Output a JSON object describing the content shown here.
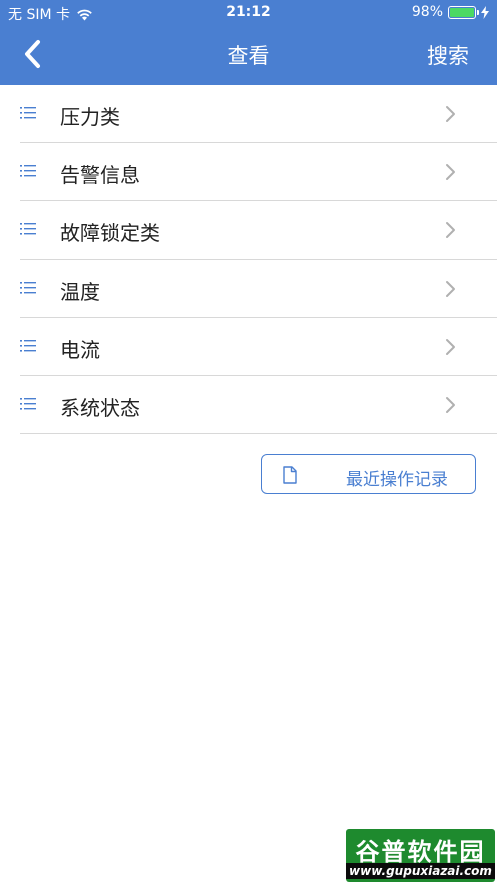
{
  "status_bar": {
    "carrier": "无 SIM 卡",
    "time": "21:12",
    "battery": "98%",
    "battery_level": 0.98
  },
  "nav": {
    "title": "查看",
    "search_label": "搜索",
    "back_icon": "chevron-left-icon"
  },
  "list": {
    "items": [
      {
        "label": "压力类"
      },
      {
        "label": "告警信息"
      },
      {
        "label": "故障锁定类"
      },
      {
        "label": "温度"
      },
      {
        "label": "电流"
      },
      {
        "label": "系统状态"
      }
    ]
  },
  "recent_button": {
    "label": "最近操作记录",
    "icon": "document-icon"
  },
  "watermark": {
    "title": "谷普软件园",
    "url": "www.gupuxiazai.com"
  },
  "colors": {
    "header": "#4a7fd1",
    "accent": "#4a7fd1",
    "battery": "#4cd964"
  }
}
